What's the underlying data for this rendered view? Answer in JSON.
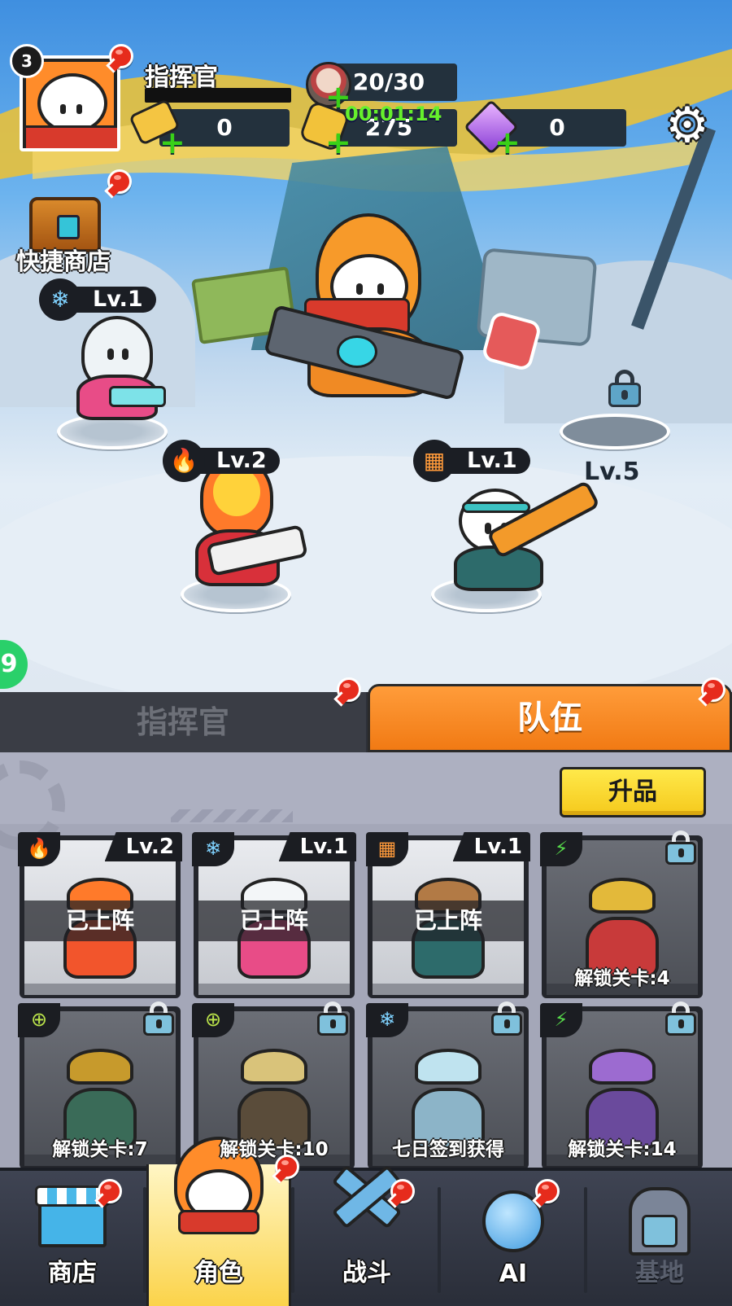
{
  "hud": {
    "player_level": "3",
    "player_name": "指挥官",
    "energy": "20/30",
    "energy_timer": "00:01:14",
    "tickets": "0",
    "gold": "275",
    "gems": "0"
  },
  "quick_shop": {
    "label": "快捷商店"
  },
  "battlefield": {
    "slots": [
      {
        "element": "ice",
        "element_icon": "snowflake-icon",
        "level": "Lv.1"
      },
      {
        "element": "fire",
        "element_icon": "flame-icon",
        "level": "Lv.2"
      },
      {
        "element": "earth",
        "element_icon": "blocks-icon",
        "level": "Lv.1"
      },
      {
        "locked": true,
        "level": "Lv.5"
      }
    ]
  },
  "tabs": {
    "commander": "指挥官",
    "team": "队伍"
  },
  "panel": {
    "upgrade_label": "升品"
  },
  "roster": [
    {
      "element_icon": "flame-icon",
      "level": "Lv.2",
      "status": "已上阵",
      "locked": false,
      "accent": "#f2552c"
    },
    {
      "element_icon": "snowflake-icon",
      "level": "Lv.1",
      "status": "已上阵",
      "locked": false,
      "accent": "#ffffff"
    },
    {
      "element_icon": "blocks-icon",
      "level": "Lv.1",
      "status": "已上阵",
      "locked": false,
      "accent": "#2d6b6b"
    },
    {
      "element_icon": "lightning-icon",
      "unlock": "解锁关卡:4",
      "locked": true,
      "accent": "#e3b93a"
    },
    {
      "element_icon": "crosshair-icon",
      "unlock": "解锁关卡:7",
      "locked": true,
      "accent": "#c79a2c"
    },
    {
      "element_icon": "crosshair-icon",
      "unlock": "解锁关卡:10",
      "locked": true,
      "accent": "#d9c37a"
    },
    {
      "element_icon": "snowflake-icon",
      "unlock": "七日签到获得",
      "locked": true,
      "accent": "#bfe3ef"
    },
    {
      "element_icon": "lightning-icon",
      "unlock": "解锁关卡:14",
      "locked": true,
      "accent": "#9c6bd0"
    }
  ],
  "nav": {
    "shop": "商店",
    "character": "角色",
    "battle": "战斗",
    "ai": "AI",
    "base": "基地"
  },
  "colors": {
    "accent_orange": "#f17a14",
    "upgrade_yellow": "#f5c91c",
    "notify_red": "#e62b1c",
    "plus_green": "#39d018",
    "timer_green": "#66f02c"
  }
}
